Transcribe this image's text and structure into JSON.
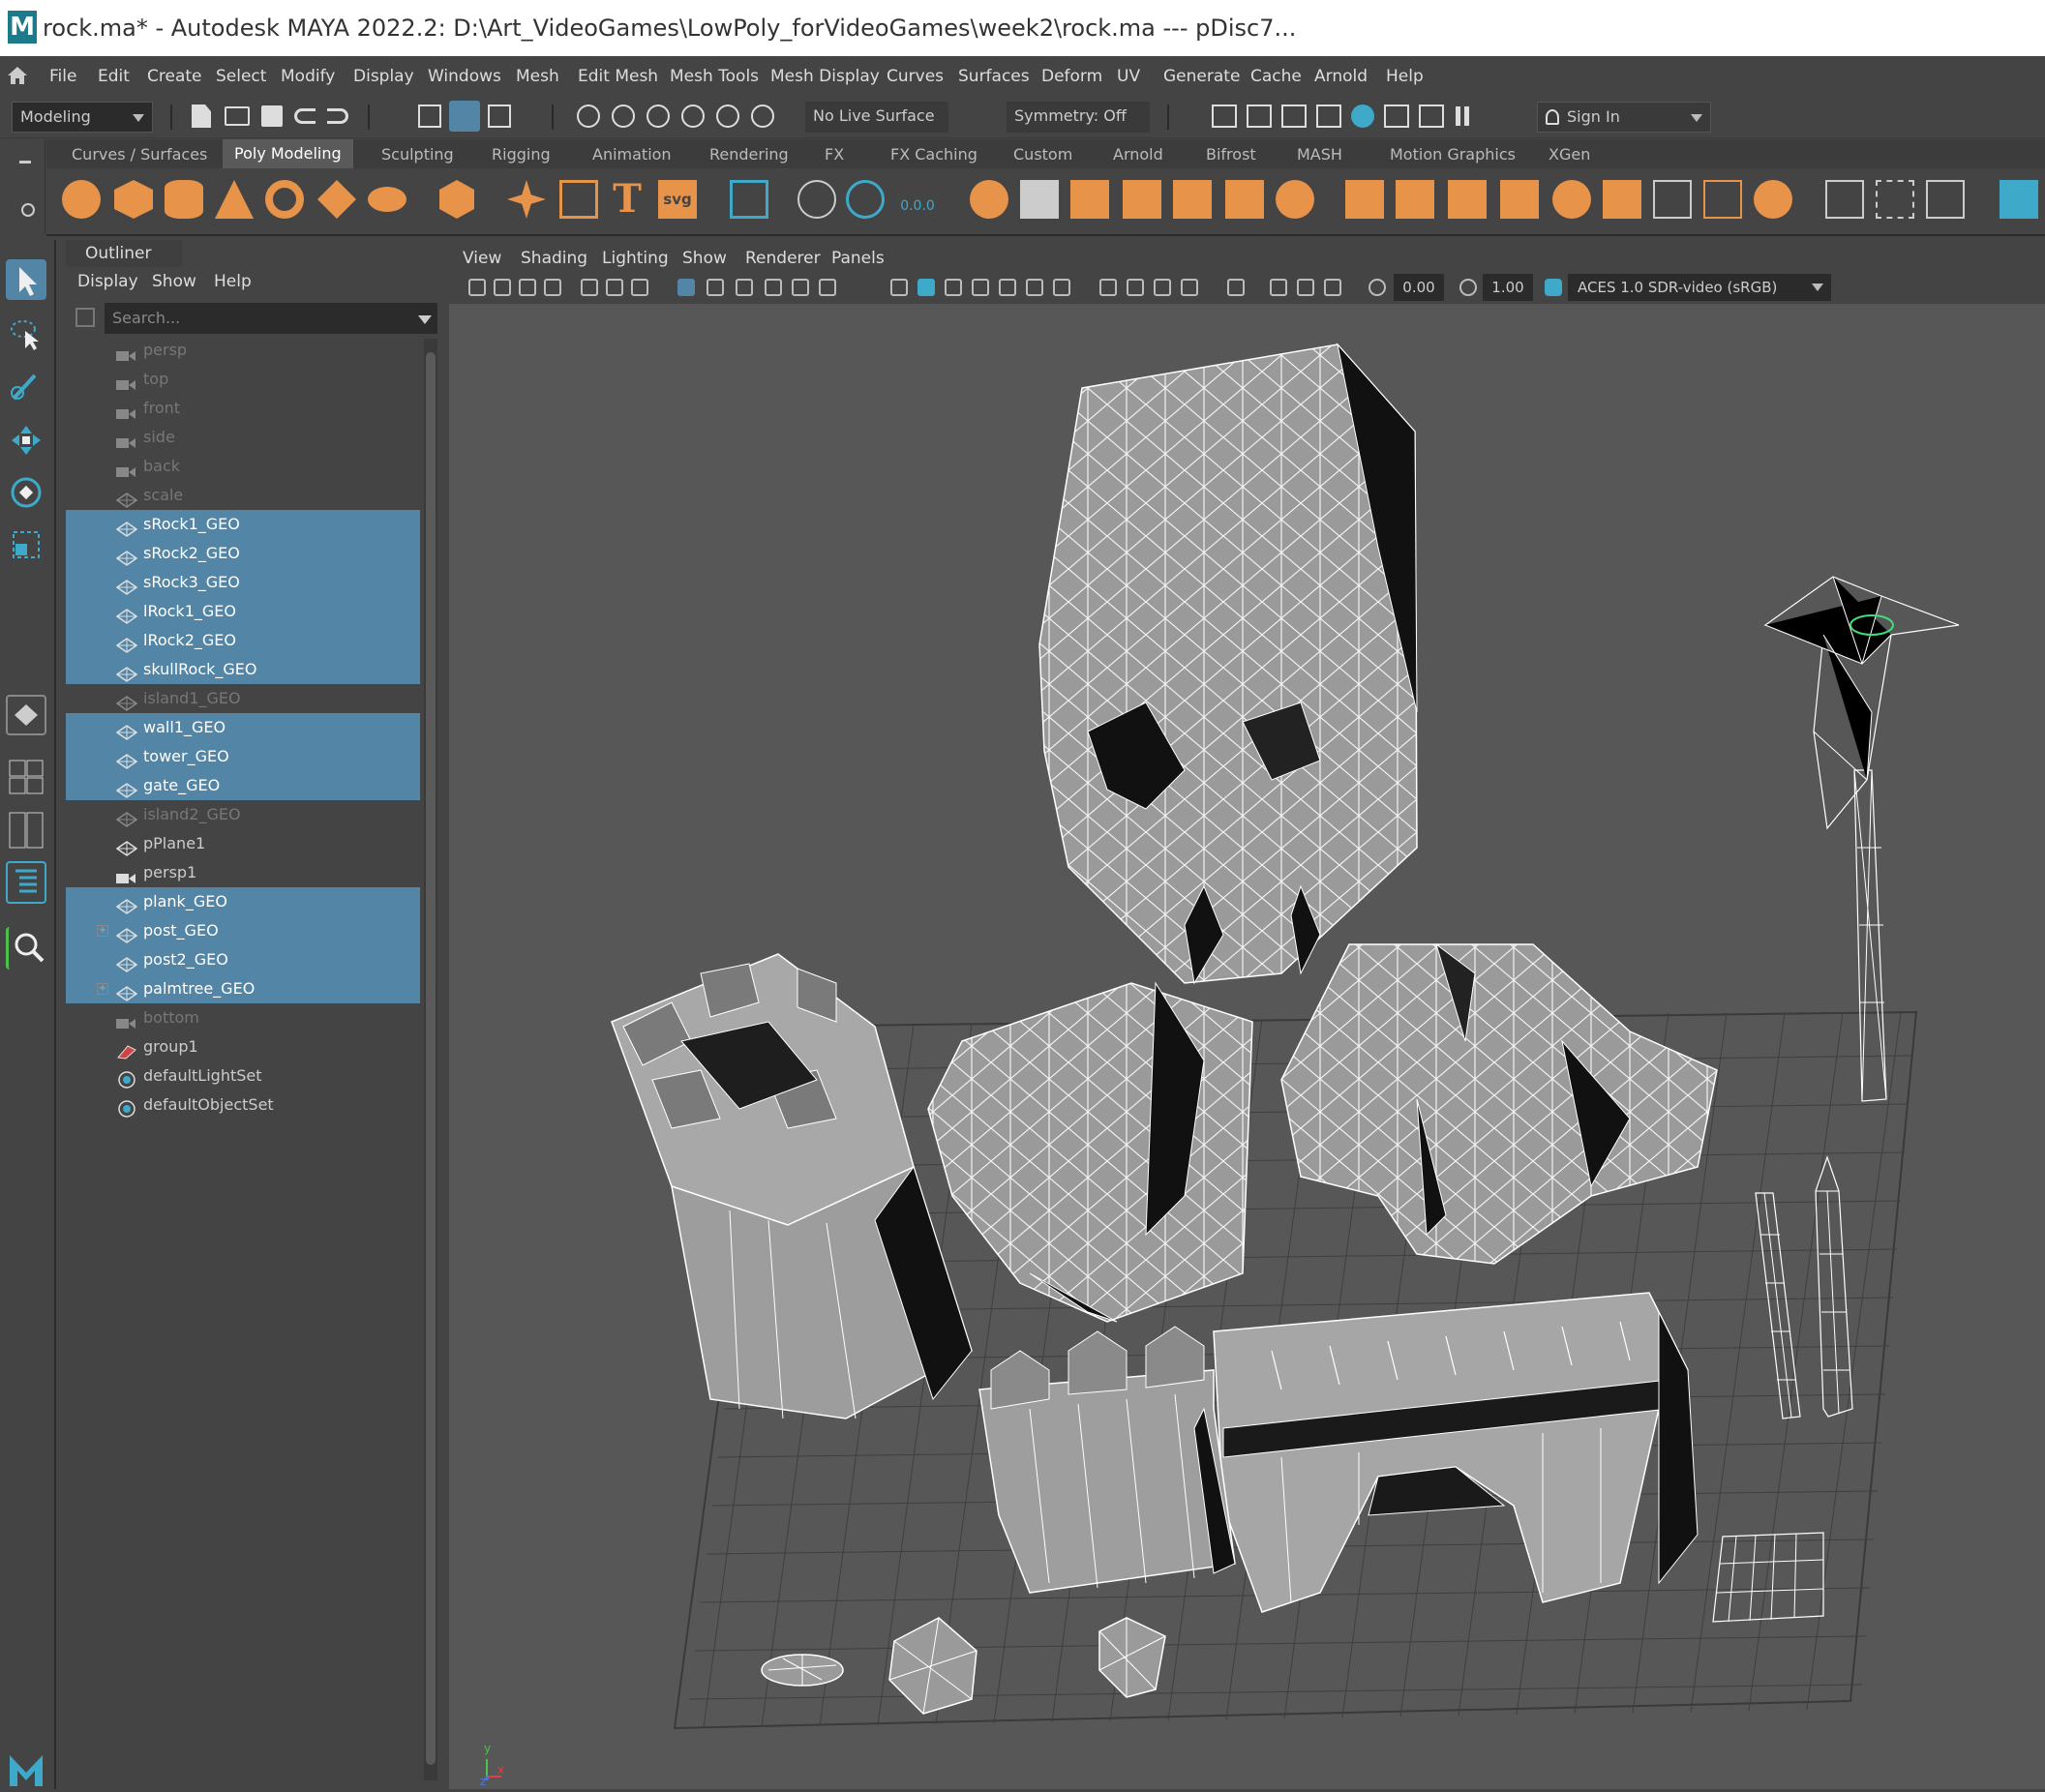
{
  "window": {
    "title": "rock.ma* - Autodesk MAYA 2022.2: D:\\Art_VideoGames\\LowPoly_forVideoGames\\week2\\rock.ma   ---   pDisc7...",
    "logo": "M"
  },
  "menubar": [
    "File",
    "Edit",
    "Create",
    "Select",
    "Modify",
    "Display",
    "Windows",
    "Mesh",
    "Edit Mesh",
    "Mesh Tools",
    "Mesh Display",
    "Curves",
    "Surfaces",
    "Deform",
    "UV",
    "Generate",
    "Cache",
    "Arnold",
    "Help"
  ],
  "statusline": {
    "mode": "Modeling",
    "live_surface": "No Live Surface",
    "symmetry": "Symmetry: Off",
    "sign_in": "Sign In"
  },
  "shelf": {
    "tabs": [
      "Curves / Surfaces",
      "Poly Modeling",
      "Sculpting",
      "Rigging",
      "Animation",
      "Rendering",
      "FX",
      "FX Caching",
      "Custom",
      "Arnold",
      "Bifrost",
      "MASH",
      "Motion Graphics",
      "XGen"
    ],
    "active_tab": "Poly Modeling",
    "counter_label": "0.0.0",
    "svg_label": "svg",
    "text_tool_label": "T"
  },
  "outliner": {
    "tab": "Outliner",
    "menu": [
      "Display",
      "Show",
      "Help"
    ],
    "search_placeholder": "Search...",
    "items": [
      {
        "label": "persp",
        "icon": "camera-icon",
        "state": "dim"
      },
      {
        "label": "top",
        "icon": "camera-icon",
        "state": "dim"
      },
      {
        "label": "front",
        "icon": "camera-icon",
        "state": "dim"
      },
      {
        "label": "side",
        "icon": "camera-icon",
        "state": "dim"
      },
      {
        "label": "back",
        "icon": "camera-icon",
        "state": "dim"
      },
      {
        "label": "scale",
        "icon": "mesh-icon",
        "state": "dim"
      },
      {
        "label": "sRock1_GEO",
        "icon": "mesh-icon",
        "state": "selected"
      },
      {
        "label": "sRock2_GEO",
        "icon": "mesh-icon",
        "state": "selected"
      },
      {
        "label": "sRock3_GEO",
        "icon": "mesh-icon",
        "state": "selected"
      },
      {
        "label": "lRock1_GEO",
        "icon": "mesh-icon",
        "state": "selected"
      },
      {
        "label": "lRock2_GEO",
        "icon": "mesh-icon",
        "state": "selected"
      },
      {
        "label": "skullRock_GEO",
        "icon": "mesh-icon",
        "state": "selected"
      },
      {
        "label": "island1_GEO",
        "icon": "mesh-icon",
        "state": "dim"
      },
      {
        "label": "wall1_GEO",
        "icon": "mesh-icon",
        "state": "selected"
      },
      {
        "label": "tower_GEO",
        "icon": "mesh-icon",
        "state": "selected"
      },
      {
        "label": "gate_GEO",
        "icon": "mesh-icon",
        "state": "selected"
      },
      {
        "label": "island2_GEO",
        "icon": "mesh-icon",
        "state": "dim"
      },
      {
        "label": "pPlane1",
        "icon": "mesh-icon",
        "state": "normal"
      },
      {
        "label": "persp1",
        "icon": "camera-icon",
        "state": "normal"
      },
      {
        "label": "plank_GEO",
        "icon": "mesh-icon",
        "state": "selected"
      },
      {
        "label": "post_GEO",
        "icon": "mesh-icon",
        "state": "selected",
        "expand": "+"
      },
      {
        "label": "post2_GEO",
        "icon": "mesh-icon",
        "state": "selected"
      },
      {
        "label": "palmtree_GEO",
        "icon": "mesh-icon",
        "state": "selected",
        "expand": "+"
      },
      {
        "label": "bottom",
        "icon": "camera-icon",
        "state": "dim"
      },
      {
        "label": "group1",
        "icon": "group-icon",
        "state": "normal"
      },
      {
        "label": "defaultLightSet",
        "icon": "set-icon",
        "state": "normal"
      },
      {
        "label": "defaultObjectSet",
        "icon": "set-icon",
        "state": "normal"
      }
    ]
  },
  "viewport": {
    "menu": [
      "View",
      "Shading",
      "Lighting",
      "Show",
      "Renderer",
      "Panels"
    ],
    "exposure": "0.00",
    "gamma": "1.00",
    "color_space": "ACES 1.0 SDR-video (sRGB)",
    "axis_y": "y",
    "axis_z": "z",
    "axis_x": "x"
  },
  "colors": {
    "selection": "#5285a6",
    "shelf_icon": "#e8934a",
    "viewport_bg": "#575757",
    "panel_bg": "#444444"
  }
}
